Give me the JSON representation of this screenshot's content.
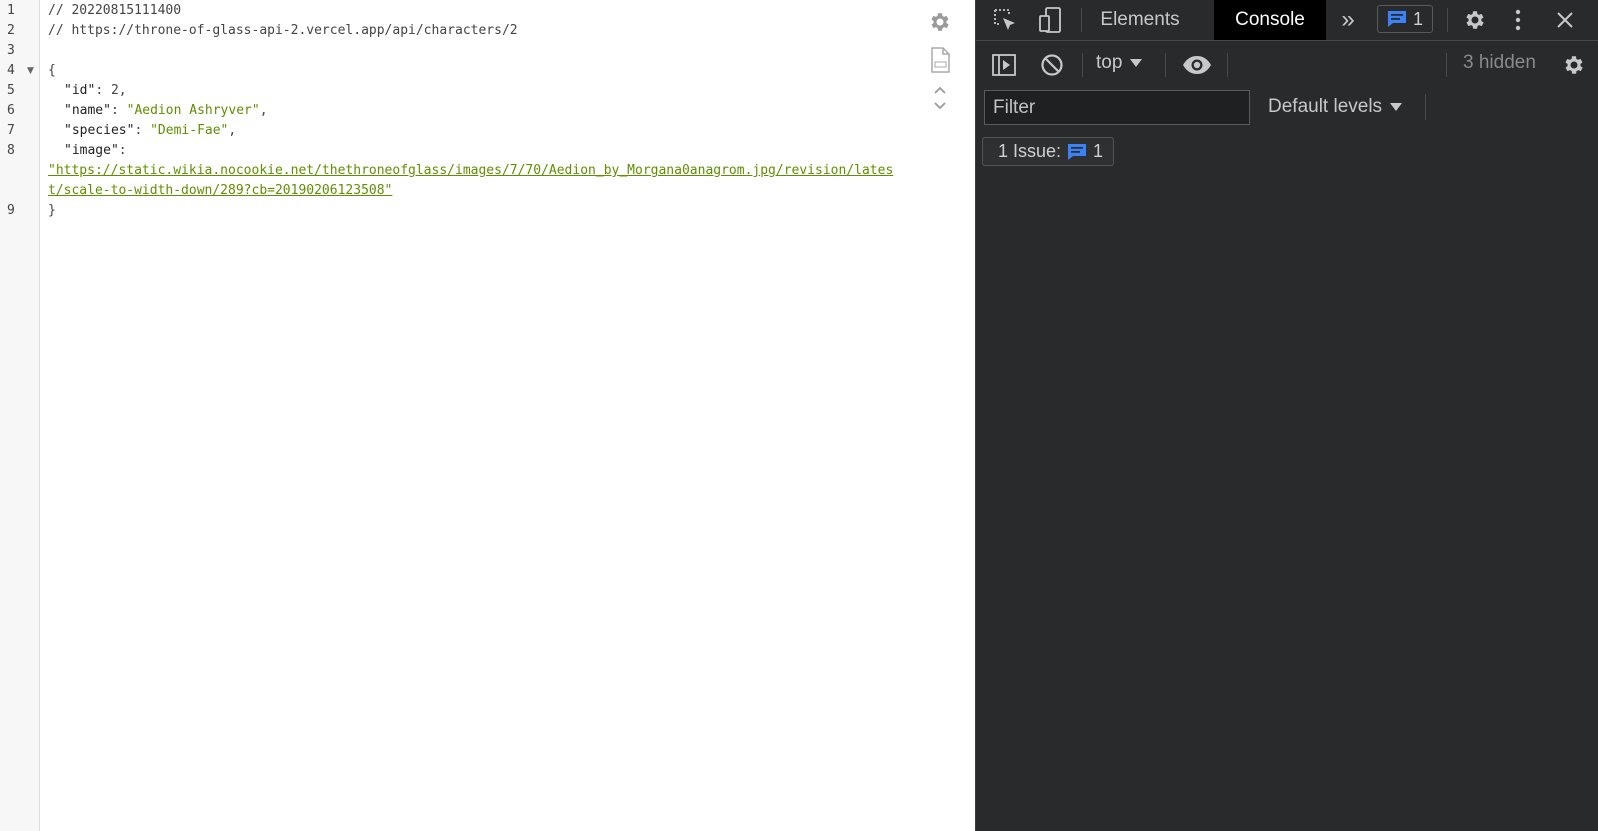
{
  "viewer": {
    "line_numbers": [
      "1",
      "2",
      "3",
      "4",
      "5",
      "6",
      "7",
      "8",
      "9"
    ],
    "comment_timestamp": "// 20220815111400",
    "comment_url": "// https://throne-of-glass-api-2.vercel.app/api/characters/2",
    "open_brace": "{",
    "close_brace": "}",
    "fields": {
      "id_key": "\"id\"",
      "id_value": "2",
      "name_key": "\"name\"",
      "name_value": "\"Aedion Ashryver\"",
      "species_key": "\"species\"",
      "species_value": "\"Demi-Fae\"",
      "image_key": "\"image\"",
      "image_value_line1": "\"https://static.wikia.nocookie.net/thethroneofglass/images/7/70/Aedion_by_Morgana0anagrom.jpg/revision/lates",
      "image_value_line2": "t/scale-to-width-down/289?cb=20190206123508\""
    },
    "icons": [
      "gear-icon",
      "raw-file-icon",
      "collapse-expand-icon"
    ]
  },
  "devtools": {
    "tabs": {
      "elements": "Elements",
      "console": "Console"
    },
    "issues_badge_count": "1",
    "context_selector": "top",
    "hidden_count": "3 hidden",
    "filter_placeholder": "Filter",
    "levels_selector": "Default levels",
    "issues_label": "1 Issue:",
    "issues_count": "1",
    "accent_color": "#3b82f6"
  }
}
